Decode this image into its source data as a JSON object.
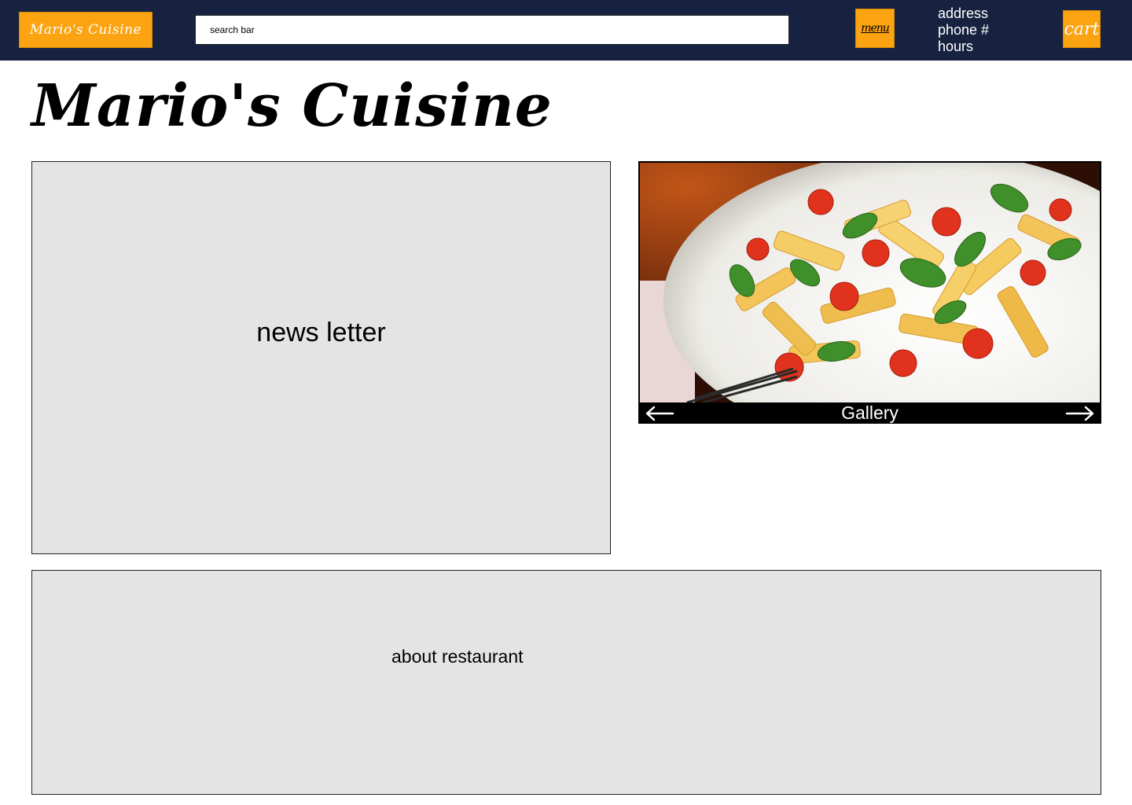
{
  "header": {
    "logo_label": "Mario's Cuisine",
    "search_placeholder": "search bar",
    "menu_label": "menu",
    "contact": [
      "address",
      "phone #",
      "hours"
    ],
    "cart_label": "cart"
  },
  "hero": {
    "title": "Mario's Cuisine"
  },
  "newsletter": {
    "label": "news letter"
  },
  "gallery": {
    "label": "Gallery",
    "image_icon": "pasta-photo",
    "prev_icon": "arrow-left-icon",
    "next_icon": "arrow-right-icon"
  },
  "about": {
    "label": "about restaurant"
  },
  "colors": {
    "header_bg": "#162240",
    "accent": "#fca311",
    "panel_bg": "#e4e4e4"
  }
}
